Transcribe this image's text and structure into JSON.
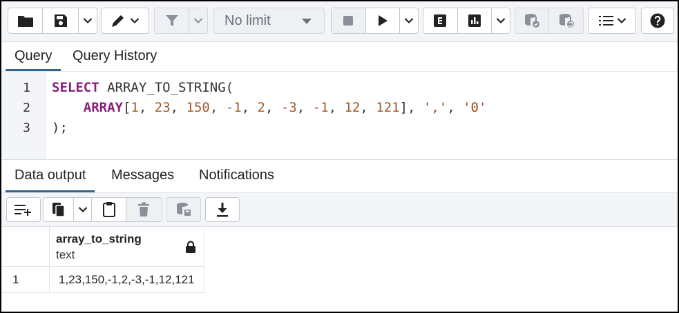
{
  "toolbar": {
    "row_limit": "No limit"
  },
  "query_tabs": [
    "Query",
    "Query History"
  ],
  "editor": {
    "line_numbers": [
      "1",
      "2",
      "3"
    ],
    "lines": [
      [
        {
          "t": "SELECT",
          "c": "kw"
        },
        {
          "t": " ARRAY_TO_STRING(",
          "c": "punc"
        }
      ],
      [
        {
          "t": "    ",
          "c": "punc"
        },
        {
          "t": "ARRAY",
          "c": "kw"
        },
        {
          "t": "[",
          "c": "punc"
        },
        {
          "t": "1",
          "c": "num"
        },
        {
          "t": ", ",
          "c": "punc"
        },
        {
          "t": "23",
          "c": "num"
        },
        {
          "t": ", ",
          "c": "punc"
        },
        {
          "t": "150",
          "c": "num"
        },
        {
          "t": ", ",
          "c": "punc"
        },
        {
          "t": "-1",
          "c": "num"
        },
        {
          "t": ", ",
          "c": "punc"
        },
        {
          "t": "2",
          "c": "num"
        },
        {
          "t": ", ",
          "c": "punc"
        },
        {
          "t": "-3",
          "c": "num"
        },
        {
          "t": ", ",
          "c": "punc"
        },
        {
          "t": "-1",
          "c": "num"
        },
        {
          "t": ", ",
          "c": "punc"
        },
        {
          "t": "12",
          "c": "num"
        },
        {
          "t": ", ",
          "c": "punc"
        },
        {
          "t": "121",
          "c": "num"
        },
        {
          "t": "], ",
          "c": "punc"
        },
        {
          "t": "','",
          "c": "str"
        },
        {
          "t": ", ",
          "c": "punc"
        },
        {
          "t": "'0'",
          "c": "str"
        }
      ],
      [
        {
          "t": ");",
          "c": "punc"
        }
      ]
    ]
  },
  "result_tabs": [
    "Data output",
    "Messages",
    "Notifications"
  ],
  "grid": {
    "column": {
      "name": "array_to_string",
      "type": "text"
    },
    "rows": [
      {
        "num": "1",
        "value": "1,23,150,-1,2,-3,-1,12,121"
      }
    ]
  },
  "colors": {
    "keyword": "#8b1f7b",
    "number": "#a05a2c",
    "string": "#a34a10",
    "active_tab_underline": "#326690"
  }
}
